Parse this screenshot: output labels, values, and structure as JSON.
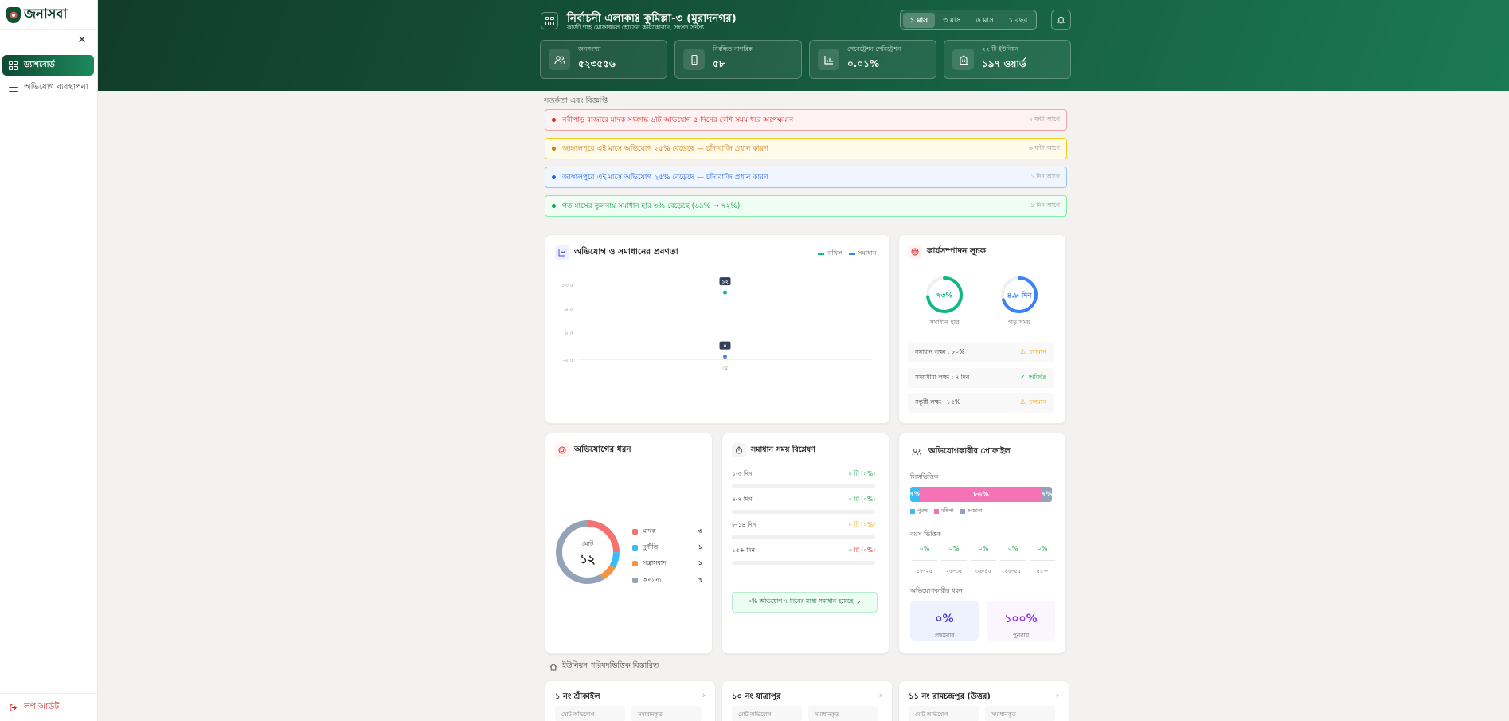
{
  "app": {
    "name": "জনাসবা"
  },
  "sidebar": {
    "items": [
      {
        "label": "ড্যাশবোর্ড",
        "active": true
      },
      {
        "label": "অভিযোগ ব্যবস্থাপনা",
        "active": false
      }
    ],
    "logout": "লগ আউট"
  },
  "header": {
    "title": "নির্বাচনী এলাকাঃ কুমিল্লা-৩ (মুরাদনগর)",
    "subtitle": "কাজী শাহ মোফাজ্জল হোসেন কায়কোবাদ, সংসদ সদস্য",
    "periods": [
      {
        "label": "১ মাস",
        "active": true
      },
      {
        "label": "৩ মাস",
        "active": false
      },
      {
        "label": "৬ মাস",
        "active": false
      },
      {
        "label": "১ বছর",
        "active": false
      }
    ],
    "stats": [
      {
        "label": "জনসংখ্যা",
        "value": "৫২৩৫৫৬",
        "icon": "users-icon"
      },
      {
        "label": "নিবন্ধিত নাগরিক",
        "value": "৫৮",
        "icon": "phone-icon"
      },
      {
        "label": "পেনেট্রেশন পেনিট্রেশন",
        "value": "০.০১%",
        "icon": "chart-icon"
      },
      {
        "label": "২২ টি ইউনিয়ন",
        "value": "১৯৭ ওয়ার্ড",
        "icon": "building-icon"
      }
    ]
  },
  "alerts": {
    "title": "সতর্কতা এবং বিজ্ঞপ্তি",
    "items": [
      {
        "text": "নবীপাড় বাজারে মাদক সংক্রান্ত ৬টি অভিযোগ ৫ দিনের বেশি সময় ধরে অপেক্ষমান",
        "time": "২ ঘন্টা আগে",
        "color": "#dc2626",
        "bg": "#fef2f2",
        "border": "#fca5a5"
      },
      {
        "text": "জাঙ্গালপুরে এই মাসে অভিযোগ ২৫% বেড়েছে — চাঁদাবাজি প্রধান কারণ",
        "time": "৬ ঘন্টা আগে",
        "color": "#d97706",
        "bg": "#fffbeb",
        "border": "#facc15"
      },
      {
        "text": "জাঙ্গালপুরে এই মাসে অভিযোগ ২৫% বেড়েছে — চাঁদাবাজি প্রধান কারণ",
        "time": "১ দিন আগে",
        "color": "#2563eb",
        "bg": "#eff6ff",
        "border": "#93c5fd"
      },
      {
        "text": "গত মাসের তুলনায় সমাধান হার ৩% বেড়েছে (৬৯% → ৭২%)",
        "time": "১ দিন আগে",
        "color": "#16a34a",
        "bg": "#f0fdf4",
        "border": "#86efac"
      }
    ]
  },
  "trend": {
    "title": "অভিযোগ ও সমাধানের প্রবণতা",
    "legend": [
      {
        "label": "দাখিল",
        "color": "#10b981"
      },
      {
        "label": "সমাধান",
        "color": "#3b82f6"
      }
    ]
  },
  "chart_data": {
    "type": "line",
    "categories": [
      "মে"
    ],
    "series": [
      {
        "name": "দাখিল",
        "values": [
          12
        ],
        "color": "#10b981"
      },
      {
        "name": "সমাধান",
        "values": [
          0
        ],
        "color": "#3b82f6"
      }
    ],
    "data_labels": [
      "১২",
      "০"
    ],
    "yticks": [
      "১৩.৫",
      "৯.০",
      "৪.৫",
      "-০.৫"
    ],
    "ylim": [
      -0.5,
      13.5
    ]
  },
  "kpi": {
    "title": "কার্যসম্পাদন সূচক",
    "rings": [
      {
        "value": "৭৩%",
        "label": "সমাধান হার",
        "fraction": 0.73,
        "color": "#10b981"
      },
      {
        "value": "৪.৮ দিন",
        "label": "গড় সময়",
        "fraction": 0.7,
        "color": "#3b82f6"
      }
    ],
    "rows": [
      {
        "label": "সমাধান লক্ষ্য : ৮০%",
        "status": "চলমান",
        "icon": "warning-icon",
        "color": "#f59e0b"
      },
      {
        "label": "সময়সীমা লক্ষ্য : ৭ দিন",
        "status": "অর্জিত",
        "icon": "check-icon",
        "color": "#16a34a"
      },
      {
        "label": "সন্তুষ্টি লক্ষ্য : ৮৫%",
        "status": "চলমান",
        "icon": "warning-icon",
        "color": "#f59e0b"
      }
    ]
  },
  "categories": {
    "title": "অভিযোগের ধরন",
    "total_label": "মোট",
    "total": "১২",
    "items": [
      {
        "label": "মাদক",
        "value": "৩",
        "count": 3,
        "color": "#f87171"
      },
      {
        "label": "দুর্নীতি",
        "value": "১",
        "count": 1,
        "color": "#38bdf8"
      },
      {
        "label": "সন্ত্রাসবাদ",
        "value": "১",
        "count": 1,
        "color": "#fb923c"
      },
      {
        "label": "অন্যান্য",
        "value": "৭",
        "count": 7,
        "color": "#94a3b8"
      }
    ]
  },
  "resolution": {
    "title": "সমাধান সময় বিশ্লেষণ",
    "rows": [
      {
        "label": "১-৩ দিন",
        "value": "০ টি (০%)",
        "color": "#16a34a"
      },
      {
        "label": "৪-৭ দিন",
        "value": "০ টি (০%)",
        "color": "#16a34a"
      },
      {
        "label": "৮-১৪ দিন",
        "value": "০ টি (০%)",
        "color": "#f59e0b"
      },
      {
        "label": "১৫+ দিন",
        "value": "০ টি (০%)",
        "color": "#dc2626"
      }
    ],
    "note": "০% অভিযোগ ৭ দিনের মধ্যে সমাধান হয়েছে"
  },
  "profile": {
    "title": "অভিযোগকারীর প্রোফাইল",
    "gender_title": "লিঙ্গভিত্তিক",
    "gender": [
      {
        "label": "পুরুষ",
        "value": "৭%",
        "pct": 7,
        "color": "#38bdf8"
      },
      {
        "label": "মহিলা",
        "value": "৮৬%",
        "pct": 86,
        "color": "#f472b6"
      },
      {
        "label": "অজানা",
        "value": "৭%",
        "pct": 7,
        "color": "#94a3b8"
      }
    ],
    "age_title": "বয়স ভিত্তিক",
    "ages": [
      {
        "label": "১৮-২৫",
        "value": "০%"
      },
      {
        "label": "২৬-৩৫",
        "value": "০%"
      },
      {
        "label": "৩৬-৪৫",
        "value": "০%"
      },
      {
        "label": "৪৬-৫৫",
        "value": "০%"
      },
      {
        "label": "৫৫+",
        "value": "০%"
      }
    ],
    "type_title": "অভিযোগকারীর ধরন",
    "types": [
      {
        "value": "০%",
        "label": "প্রথমবার",
        "color": "#4338ca",
        "bg": "#eef2ff"
      },
      {
        "value": "১০০%",
        "label": "পুনরায়",
        "color": "#9333ea",
        "bg": "#faf5ff"
      }
    ]
  },
  "unions": {
    "title": "ইউনিয়ন পরিষদভিত্তিক বিস্তারিত",
    "items": [
      {
        "name": "১ নং শ্রীকাইল",
        "sub1": "মোট অভিযোগ",
        "sub2": "সমাধানকৃত"
      },
      {
        "name": "১০ নং যাত্রাপুর",
        "sub1": "মোট অভিযোগ",
        "sub2": "সমাধানকৃত"
      },
      {
        "name": "১১ নং রামচন্দ্রপুর (উত্তর)",
        "sub1": "মোট অভিযোগ",
        "sub2": "সমাধানকৃত"
      }
    ]
  }
}
